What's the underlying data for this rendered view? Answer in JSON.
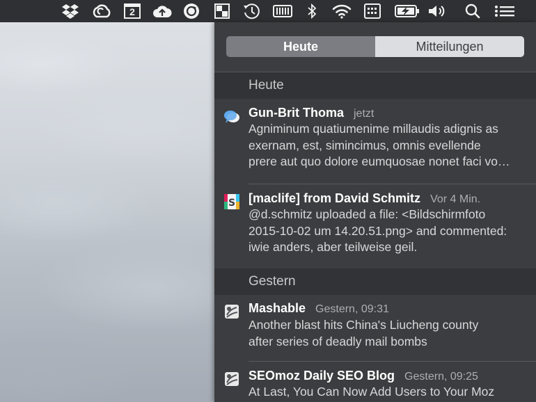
{
  "menubar": {
    "calendar_day": "2",
    "icons": [
      "dropbox-icon",
      "creative-cloud-icon",
      "calendar-icon",
      "cloud-upload-icon",
      "sync-icon",
      "resize-icon",
      "time-machine-icon",
      "memory-icon",
      "bluetooth-icon",
      "wifi-icon",
      "keyboard-icon",
      "battery-icon",
      "volume-icon",
      "search-icon",
      "list-icon"
    ]
  },
  "notification_center": {
    "tabs": [
      "Heute",
      "Mitteilungen"
    ],
    "active_tab": "Heute",
    "sections": [
      {
        "header": "Heute",
        "items": [
          {
            "app_icon": "messages-icon",
            "title": "Gun-Brit Thoma",
            "time": "jetzt",
            "body": [
              "Agniminum quatiumenime millaudis adignis as",
              "exernam, est, simincimus, omnis evellende",
              "prere aut quo dolore eumquosae nonet faci vo…"
            ]
          },
          {
            "app_icon": "slack-icon",
            "title": "[maclife] from David Schmitz",
            "time": "Vor 4 Min.",
            "body": [
              "@d.schmitz uploaded a file: <Bildschirmfoto",
              "2015-10-02 um 14.20.51.png> and commented:",
              "iwie anders, aber teilweise geil."
            ]
          }
        ]
      },
      {
        "header": "Gestern",
        "items": [
          {
            "app_icon": "rss-reader-icon",
            "title": "Mashable",
            "time": "Gestern, 09:31",
            "body": [
              "Another blast hits China's Liucheng county",
              "after series of deadly mail bombs"
            ]
          },
          {
            "app_icon": "rss-reader-icon",
            "title": "SEOmoz Daily SEO Blog",
            "time": "Gestern, 09:25",
            "body": [
              "At Last, You Can Now Add Users to Your Moz"
            ]
          }
        ]
      }
    ]
  }
}
